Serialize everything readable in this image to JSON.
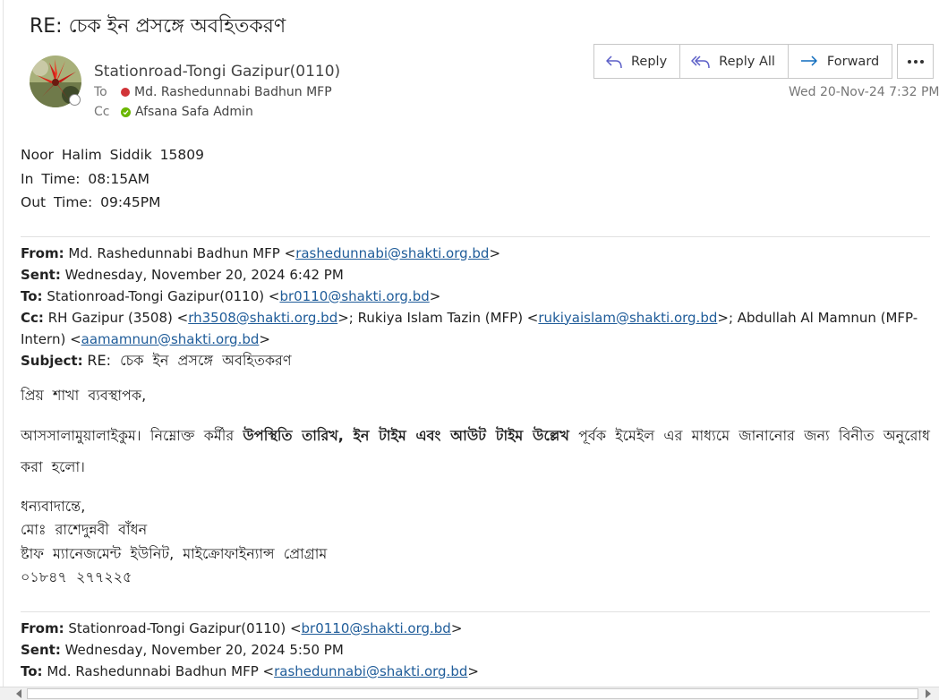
{
  "email": {
    "subject": "RE: চেক ইন প্রসঙ্গে অবহিতকরণ",
    "sender": "Stationroad-Tongi Gazipur(0110)",
    "to_label": "To",
    "to_name": "Md. Rashedunnabi Badhun MFP",
    "cc_label": "Cc",
    "cc_name": "Afsana Safa Admin",
    "date": "Wed 20-Nov-24 7:32 PM"
  },
  "actions": {
    "reply": "Reply",
    "reply_all": "Reply All",
    "forward": "Forward"
  },
  "body": {
    "line1": "Noor  Halim  Siddik  15809",
    "line2": "In  Time:  08:15AM",
    "line3": "Out  Time:  09:45PM"
  },
  "quoted1": {
    "from_label": "From:",
    "from_name": "Md. Rashedunnabi Badhun MFP <",
    "from_email": "rashedunnabi@shakti.org.bd",
    "sent_label": "Sent:",
    "sent_value": "Wednesday, November 20, 2024 6:42 PM",
    "to_label": "To:",
    "to_name": "Stationroad-Tongi Gazipur(0110) <",
    "to_email": "br0110@shakti.org.bd",
    "cc_label": "Cc:",
    "cc_name1": "RH Gazipur (3508) <",
    "cc_email1": "rh3508@shakti.org.bd",
    "cc_name2": ">; Rukiya Islam Tazin (MFP) <",
    "cc_email2": "rukiyaislam@shakti.org.bd",
    "cc_name3": ">; Abdullah Al Mamnun (MFP-Intern) <",
    "cc_email3": "aamamnun@shakti.org.bd",
    "subject_label": "Subject:",
    "subject_value": "RE: চেক ইন প্রসঙ্গে অবহিতকরণ",
    "greeting": "প্রিয় শাখা ব্যবস্থাপক,",
    "msg_a": "আসসালামুয়ালাইকুম। নিম্নোক্ত কর্মীর ",
    "msg_bold": "উপস্থিতি তারিখ, ইন টাইম এবং আউট টাইম উল্লেখ",
    "msg_b": " পূর্বক ইমেইল এর মাধ্যমে জানানোর জন্য বিনীত অনুরোধ করা হলো।",
    "sig1": "ধন্যবাদান্তে,",
    "sig2": "মোঃ রাশেদুন্নবী বাঁধন",
    "sig3": "ষ্টাফ ম্যানেজমেন্ট ইউনিট, মাইক্রোফাইন্যান্স প্রোগ্রাম",
    "sig4": "০১৮৪৭ ২৭৭২২৫"
  },
  "quoted2": {
    "from_label": "From:",
    "from_name": "Stationroad-Tongi Gazipur(0110) <",
    "from_email": "br0110@shakti.org.bd",
    "sent_label": "Sent:",
    "sent_value": "Wednesday, November 20, 2024 5:50 PM",
    "to_label": "To:",
    "to_name": "Md. Rashedunnabi Badhun MFP <",
    "to_email": "rashedunnabi@shakti.org.bd"
  },
  "icons": {
    "reply": "reply-arrow-icon",
    "reply_all": "reply-all-arrow-icon",
    "forward": "forward-arrow-icon",
    "more": "more-dots-icon"
  },
  "colors": {
    "accent": "#0f6cbd",
    "link": "#1f5c99",
    "presence_busy": "#d13438",
    "presence_available": "#6bb700"
  }
}
